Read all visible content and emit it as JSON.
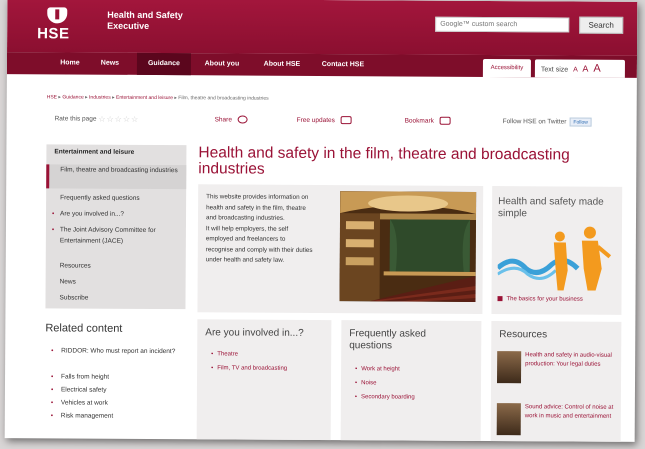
{
  "header": {
    "logo_text": "HSE",
    "org_name": "Health and Safety Executive",
    "search_placeholder": "Google™ custom search",
    "search_button": "Search"
  },
  "nav": {
    "items": [
      "Home",
      "News",
      "Guidance",
      "About you",
      "About HSE",
      "Contact HSE"
    ],
    "active": "Guidance",
    "accessibility": "Accessibility",
    "text_size_label": "Text size",
    "text_size_options": [
      "A",
      "A",
      "A"
    ]
  },
  "breadcrumb": {
    "links": [
      "HSE",
      "Guidance",
      "Industries",
      "Entertainment and leisure"
    ],
    "current": "Film, theatre and broadcasting industries",
    "separator": "▸"
  },
  "toolbar": {
    "rate_label": "Rate this page",
    "share": "Share",
    "free_updates": "Free updates",
    "bookmark": "Bookmark",
    "follow_twitter": "Follow HSE on Twitter",
    "follow_button": "Follow"
  },
  "leftnav": {
    "heading": "Entertainment and leisure",
    "items": [
      "Film, theatre and broadcasting industries",
      "Frequently asked questions",
      "Are you involved in...?",
      "The Joint Advisory Committee for Entertainment (JACE)",
      "Resources",
      "News",
      "Subscribe"
    ]
  },
  "related": {
    "heading": "Related content",
    "items": [
      "RIDDOR: Who must report an incident?",
      "Falls from height",
      "Electrical safety",
      "Vehicles at work",
      "Risk management"
    ]
  },
  "main": {
    "title": "Health and safety in the film, theatre and broadcasting industries",
    "intro_lines": [
      "This website provides information on",
      "health and safety in the film, theatre",
      "and broadcasting industries.",
      "It will help employers, the self",
      "employed and freelancers to",
      "recognise and comply with their duties",
      "under health and safety law."
    ]
  },
  "promo": {
    "title": "Health and safety made simple",
    "link": "The basics for your business"
  },
  "cards": {
    "involved": {
      "title": "Are you involved in...?",
      "items": [
        "Theatre",
        "Film, TV and broadcasting"
      ]
    },
    "faq": {
      "title": "Frequently asked questions",
      "items": [
        "Work at height",
        "Noise",
        "Secondary boarding"
      ]
    },
    "resources": {
      "title": "Resources",
      "items": [
        "Health and safety in audio-visual production: Your legal duties",
        "Sound advice: Control of noise at work in music and entertainment"
      ]
    }
  },
  "colors": {
    "brand": "#9a1236",
    "nav": "#7e0d2a",
    "panel": "#f0eeee"
  }
}
